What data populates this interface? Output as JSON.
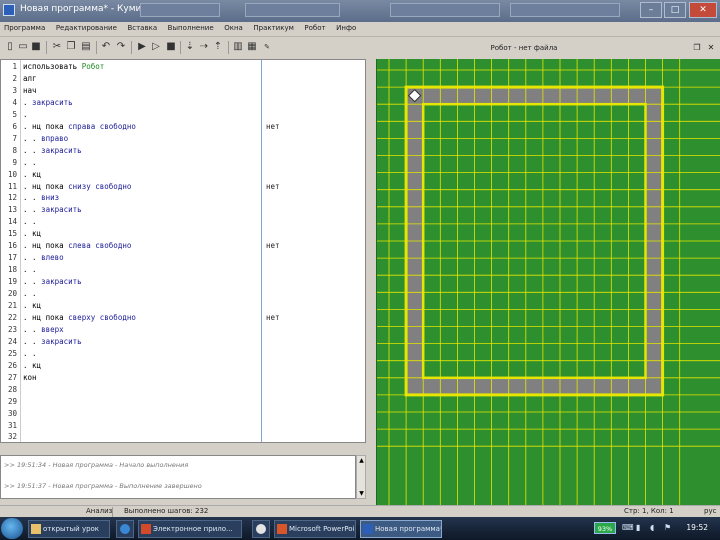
{
  "window": {
    "title": "Новая программа* - Кумир",
    "minimize": "–",
    "maximize": "□",
    "close": "✕"
  },
  "menu": [
    "Программа",
    "Редактирование",
    "Вставка",
    "Выполнение",
    "Окна",
    "Практикум",
    "Робот",
    "Инфо"
  ],
  "toolbar": {
    "icons": [
      "new-file-icon",
      "open-file-icon",
      "save-icon",
      "cut-icon",
      "copy-icon",
      "paste-icon",
      "undo-icon",
      "redo-icon",
      "run-icon",
      "step-run-icon",
      "step-into-icon",
      "stop-icon",
      "step-over-icon",
      "step-out-icon",
      "toggle-margin-icon",
      "grid-icon",
      "robot-view-icon",
      "pin-icon"
    ]
  },
  "editor": {
    "line_numbers": [
      "1",
      "2",
      "3",
      "4",
      "5",
      "6",
      "7",
      "8",
      "9",
      "10",
      "11",
      "12",
      "13",
      "14",
      "15",
      "16",
      "17",
      "18",
      "19",
      "20",
      "21",
      "22",
      "23",
      "24",
      "25",
      "26",
      "27",
      "28",
      "29",
      "30",
      "31",
      "32"
    ],
    "lines": [
      [
        {
          "t": "использовать ",
          "c": "kw"
        },
        {
          "t": "Робот",
          "c": "gr"
        }
      ],
      [
        {
          "t": "алг",
          "c": "kw"
        }
      ],
      [
        {
          "t": "нач",
          "c": "kw"
        }
      ],
      [
        {
          "t": ". ",
          "c": "kw"
        },
        {
          "t": "закрасить",
          "c": "cm"
        }
      ],
      [
        {
          "t": ".",
          "c": "kw"
        }
      ],
      [
        {
          "t": ". нц пока ",
          "c": "kw"
        },
        {
          "t": "справа свободно",
          "c": "cm"
        }
      ],
      [
        {
          "t": ". . ",
          "c": "kw"
        },
        {
          "t": "вправо",
          "c": "cm"
        }
      ],
      [
        {
          "t": ". . ",
          "c": "kw"
        },
        {
          "t": "закрасить",
          "c": "cm"
        }
      ],
      [
        {
          "t": ". .",
          "c": "kw"
        }
      ],
      [
        {
          "t": ". кц",
          "c": "kw"
        }
      ],
      [
        {
          "t": ". нц пока ",
          "c": "kw"
        },
        {
          "t": "снизу свободно",
          "c": "cm"
        }
      ],
      [
        {
          "t": ". . ",
          "c": "kw"
        },
        {
          "t": "вниз",
          "c": "cm"
        }
      ],
      [
        {
          "t": ". . ",
          "c": "kw"
        },
        {
          "t": "закрасить",
          "c": "cm"
        }
      ],
      [
        {
          "t": ". .",
          "c": "kw"
        }
      ],
      [
        {
          "t": ". кц",
          "c": "kw"
        }
      ],
      [
        {
          "t": ". нц пока ",
          "c": "kw"
        },
        {
          "t": "слева свободно",
          "c": "cm"
        }
      ],
      [
        {
          "t": ". . ",
          "c": "kw"
        },
        {
          "t": "влево",
          "c": "cm"
        }
      ],
      [
        {
          "t": ". .",
          "c": "kw"
        }
      ],
      [
        {
          "t": ". . ",
          "c": "kw"
        },
        {
          "t": "закрасить",
          "c": "cm"
        }
      ],
      [
        {
          "t": ". .",
          "c": "kw"
        }
      ],
      [
        {
          "t": ". кц",
          "c": "kw"
        }
      ],
      [
        {
          "t": ". нц пока ",
          "c": "kw"
        },
        {
          "t": "сверху свободно",
          "c": "cm"
        }
      ],
      [
        {
          "t": ". . ",
          "c": "kw"
        },
        {
          "t": "вверх",
          "c": "cm"
        }
      ],
      [
        {
          "t": ". . ",
          "c": "kw"
        },
        {
          "t": "закрасить",
          "c": "cm"
        }
      ],
      [
        {
          "t": ". .",
          "c": "kw"
        }
      ],
      [
        {
          "t": ". кц",
          "c": "kw"
        }
      ],
      [
        {
          "t": "кон",
          "c": "kw"
        }
      ],
      [],
      [],
      [],
      [],
      []
    ],
    "margin_values": [
      {
        "line": 6,
        "text": "нет"
      },
      {
        "line": 11,
        "text": "нет"
      },
      {
        "line": 16,
        "text": "нет"
      },
      {
        "line": 22,
        "text": "нет"
      }
    ]
  },
  "robot_panel": {
    "title": "Робот - нет файла",
    "grid_cols": 17,
    "grid_rows": 20,
    "painted_ring": {
      "col_from": 1,
      "col_to": 15,
      "row_from": 1,
      "row_to": 18
    },
    "robot_cell": {
      "col": 1,
      "row": 1
    },
    "colors": {
      "field": "#2e8f2e",
      "grid": "#e6e600",
      "painted": "#808080",
      "walls": "#e6e600"
    }
  },
  "log": {
    "lines": [
      ">> 19:51:34 - Новая программа - Начало выполнения",
      ">> 19:51:37 - Новая программа - Выполнение завершено"
    ]
  },
  "statusbar": {
    "mode": "Анализ",
    "steps": "Выполнено шагов: 232",
    "position": "Стр: 1, Кол: 1",
    "lang": "рус"
  },
  "taskbar": {
    "buttons": [
      {
        "label": "открытый урок",
        "active": false
      },
      {
        "label": "Электронное прило...",
        "active": false
      },
      {
        "label": "Microsoft PowerPoint...",
        "active": false
      },
      {
        "label": "Новая программа*...",
        "active": true
      }
    ],
    "battery": "93%",
    "clock": "19:52"
  }
}
